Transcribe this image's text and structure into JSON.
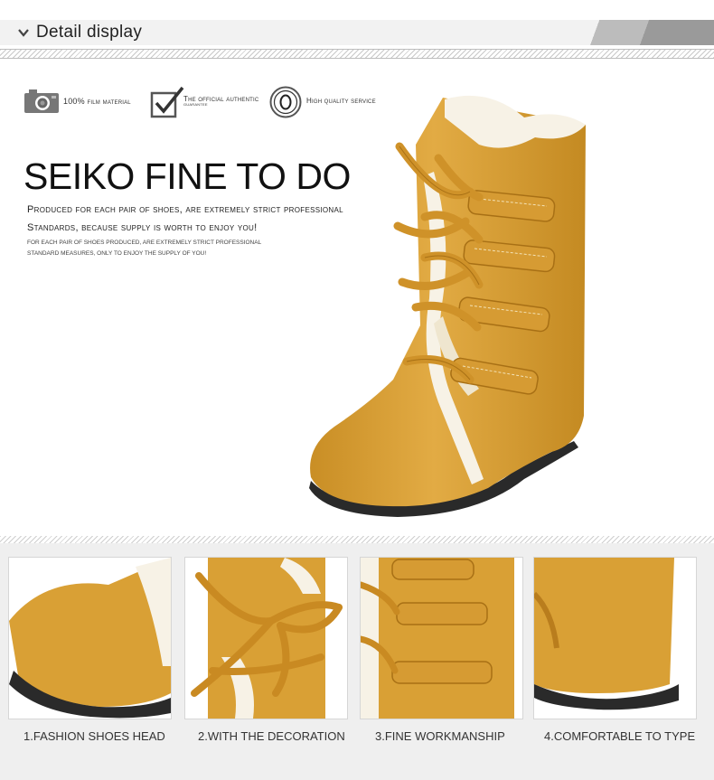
{
  "header": {
    "title": "Detail display"
  },
  "badges": [
    {
      "icon": "camera-icon",
      "label": "100% film material"
    },
    {
      "icon": "check-icon",
      "label": "The official authentic",
      "sub": "guarantee"
    },
    {
      "icon": "circle-o-icon",
      "label": "High quality service"
    }
  ],
  "hero": {
    "title": "SEIKO FINE TO DO",
    "line1": "Produced for each pair of shoes, are extremely strict professional",
    "line2": "Standards, because supply is worth to enjoy you!",
    "line3": "FOR EACH PAIR OF SHOES PRODUCED, ARE EXTREMELY STRICT PROFESSIONAL",
    "line4": "STANDARD MEASURES, ONLY TO ENJOY THE SUPPLY OF YOU!"
  },
  "details": [
    {
      "caption": "1.FASHION SHOES HEAD"
    },
    {
      "caption": "2.WITH THE DECORATION"
    },
    {
      "caption": "3.FINE WORKMANSHIP"
    },
    {
      "caption": "4.COMFORTABLE TO TYPE"
    }
  ],
  "colors": {
    "suede": "#d9a035",
    "suede_dark": "#b97d1d",
    "fur": "#f7f2e6",
    "sole": "#2a2a2a"
  }
}
